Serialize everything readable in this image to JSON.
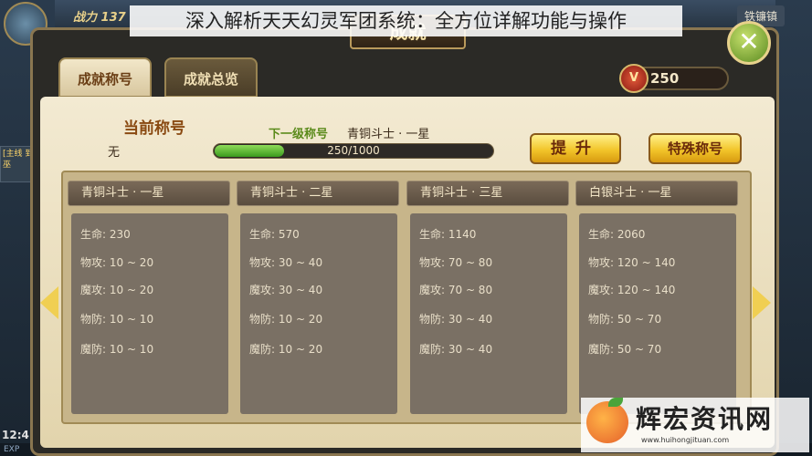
{
  "caption": "深入解析天天幻灵军团系统：全方位详解功能与操作",
  "hud": {
    "power_label": "战力 137",
    "town": "铁镰镇",
    "side_text": "[主线 到巫",
    "time": "12:4",
    "exp": "EXP"
  },
  "dialog": {
    "title": "成就",
    "close_glyph": "✕",
    "tabs": [
      {
        "label": "成就称号",
        "active": true
      },
      {
        "label": "成就总览",
        "active": false
      }
    ],
    "points": {
      "icon_text": "V",
      "value": "250"
    },
    "current": {
      "label": "当前称号",
      "value": "无"
    },
    "next": {
      "label": "下一级称号",
      "value": "青铜斗士 · 一星"
    },
    "progress": {
      "text": "250/1000",
      "fraction": 0.25
    },
    "buttons": {
      "upgrade": "提升",
      "special": "特殊称号"
    },
    "cards": [
      {
        "name": "青铜斗士 · 一星",
        "stats": [
          "生命: 230",
          "物攻: 10 ~ 20",
          "魔攻: 10 ~ 20",
          "物防: 10 ~ 10",
          "魔防: 10 ~ 10"
        ]
      },
      {
        "name": "青铜斗士 · 二星",
        "stats": [
          "生命: 570",
          "物攻: 30 ~ 40",
          "魔攻: 30 ~ 40",
          "物防: 10 ~ 20",
          "魔防: 10 ~ 20"
        ]
      },
      {
        "name": "青铜斗士 · 三星",
        "stats": [
          "生命: 1140",
          "物攻: 70 ~ 80",
          "魔攻: 70 ~ 80",
          "物防: 30 ~ 40",
          "魔防: 30 ~ 40"
        ]
      },
      {
        "name": "白银斗士 · 一星",
        "stats": [
          "生命: 2060",
          "物攻: 120 ~ 140",
          "魔攻: 120 ~ 140",
          "物防: 50 ~ 70",
          "魔防: 50 ~ 70"
        ]
      }
    ]
  },
  "watermark": {
    "text": "辉宏资讯网",
    "url": "www.huihongjituan.com"
  }
}
